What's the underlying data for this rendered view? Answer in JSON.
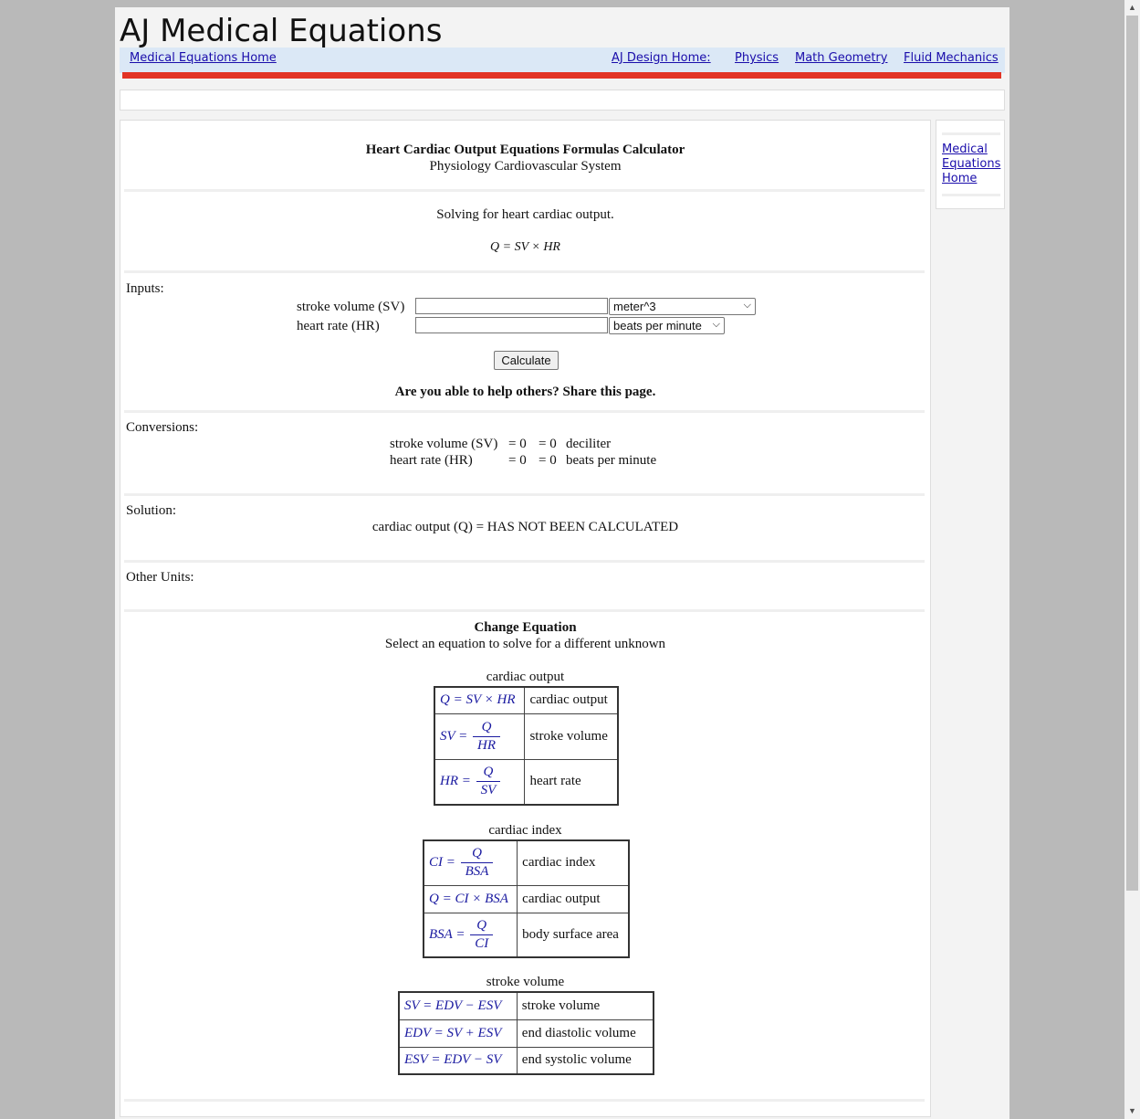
{
  "site": {
    "title": "AJ Medical Equations",
    "nav": {
      "home": "Medical Equations Home",
      "design_home": "AJ Design Home:",
      "physics": "Physics",
      "math": "Math Geometry",
      "fluid": "Fluid Mechanics"
    }
  },
  "sidebar": {
    "link": "Medical Equations Home"
  },
  "header": {
    "title": "Heart Cardiac Output Equations Formulas Calculator",
    "subtitle": "Physiology Cardiovascular System"
  },
  "solving": {
    "text": "Solving for heart cardiac output.",
    "equation": "Q = SV × HR"
  },
  "inputs": {
    "label": "Inputs:",
    "sv_label": "stroke volume (SV)",
    "sv_value": "",
    "sv_unit": "meter^3",
    "hr_label": "heart rate (HR)",
    "hr_value": "",
    "hr_unit": "beats per minute",
    "button": "Calculate",
    "share": "Are you able to help others? Share this page."
  },
  "conversions": {
    "label": "Conversions:",
    "rows": [
      {
        "label": "stroke volume (SV)",
        "value": "= 0",
        "converted": "= 0",
        "unit": "deciliter"
      },
      {
        "label": "heart rate (HR)",
        "value": "= 0",
        "converted": "= 0",
        "unit": "beats per minute"
      }
    ]
  },
  "solution": {
    "label": "Solution:",
    "text": "cardiac output (Q) = HAS NOT BEEN CALCULATED"
  },
  "other_units": {
    "label": "Other Units:"
  },
  "change": {
    "title": "Change Equation",
    "subtitle": "Select an equation to solve for a different unknown",
    "tables": [
      {
        "caption": "cardiac output",
        "rows": [
          {
            "lhs": "Q",
            "rhs": "SV × HR",
            "desc": "cardiac output"
          },
          {
            "lhs": "SV",
            "num": "Q",
            "den": "HR",
            "desc": "stroke volume"
          },
          {
            "lhs": "HR",
            "num": "Q",
            "den": "SV",
            "desc": "heart rate"
          }
        ]
      },
      {
        "caption": "cardiac index",
        "rows": [
          {
            "lhs": "CI",
            "num": "Q",
            "den": "BSA",
            "desc": "cardiac index"
          },
          {
            "lhs": "Q",
            "rhs": "CI × BSA",
            "desc": "cardiac output"
          },
          {
            "lhs": "BSA",
            "num": "Q",
            "den": "CI",
            "desc": "body surface area"
          }
        ]
      },
      {
        "caption": "stroke volume",
        "rows": [
          {
            "lhs": "SV",
            "rhs": "EDV − ESV",
            "desc": "stroke volume"
          },
          {
            "lhs": "EDV",
            "rhs": "SV + ESV",
            "desc": "end diastolic volume"
          },
          {
            "lhs": "ESV",
            "rhs": "EDV − SV",
            "desc": "end systolic volume"
          }
        ]
      }
    ]
  }
}
